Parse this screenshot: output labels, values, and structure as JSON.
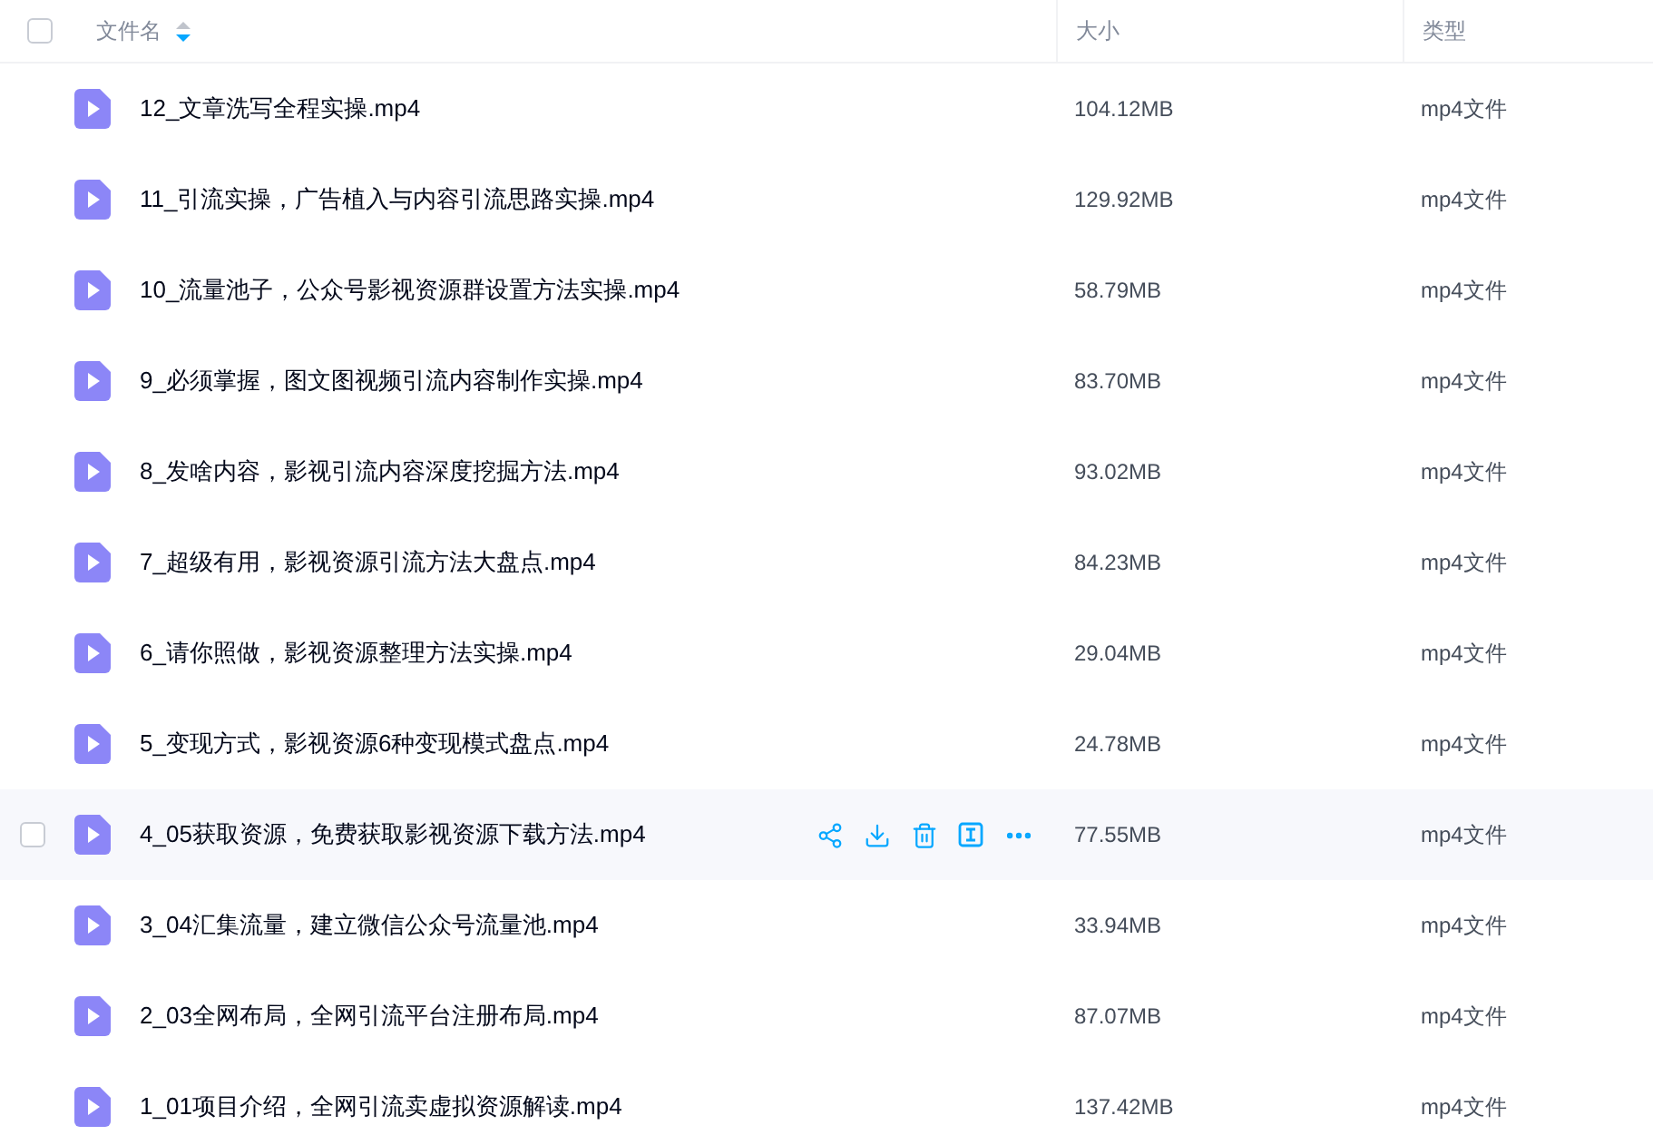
{
  "header": {
    "select_all": {
      "checked": false
    },
    "columns": [
      {
        "label": "文件名",
        "sorted_descending": true
      },
      {
        "label": "大小"
      },
      {
        "label": "类型"
      }
    ]
  },
  "rows": [
    {
      "name": "12_文章洗写全程实操.mp4",
      "size": "104.12MB",
      "type": "mp4文件",
      "hovered": false
    },
    {
      "name": "11_引流实操，广告植入与内容引流思路实操.mp4",
      "size": "129.92MB",
      "type": "mp4文件",
      "hovered": false
    },
    {
      "name": "10_流量池子，公众号影视资源群设置方法实操.mp4",
      "size": "58.79MB",
      "type": "mp4文件",
      "hovered": false
    },
    {
      "name": "9_必须掌握，图文图视频引流内容制作实操.mp4",
      "size": "83.70MB",
      "type": "mp4文件",
      "hovered": false
    },
    {
      "name": "8_发啥内容，影视引流内容深度挖掘方法.mp4",
      "size": "93.02MB",
      "type": "mp4文件",
      "hovered": false
    },
    {
      "name": "7_超级有用，影视资源引流方法大盘点.mp4",
      "size": "84.23MB",
      "type": "mp4文件",
      "hovered": false
    },
    {
      "name": "6_请你照做，影视资源整理方法实操.mp4",
      "size": "29.04MB",
      "type": "mp4文件",
      "hovered": false
    },
    {
      "name": "5_变现方式，影视资源6种变现模式盘点.mp4",
      "size": "24.78MB",
      "type": "mp4文件",
      "hovered": false
    },
    {
      "name": "4_05获取资源，免费获取影视资源下载方法.mp4",
      "size": "77.55MB",
      "type": "mp4文件",
      "hovered": true
    },
    {
      "name": "3_04汇集流量，建立微信公众号流量池.mp4",
      "size": "33.94MB",
      "type": "mp4文件",
      "hovered": false
    },
    {
      "name": "2_03全网布局，全网引流平台注册布局.mp4",
      "size": "87.07MB",
      "type": "mp4文件",
      "hovered": false
    },
    {
      "name": "1_01项目介绍，全网引流卖虚拟资源解读.mp4",
      "size": "137.42MB",
      "type": "mp4文件",
      "hovered": false
    }
  ]
}
